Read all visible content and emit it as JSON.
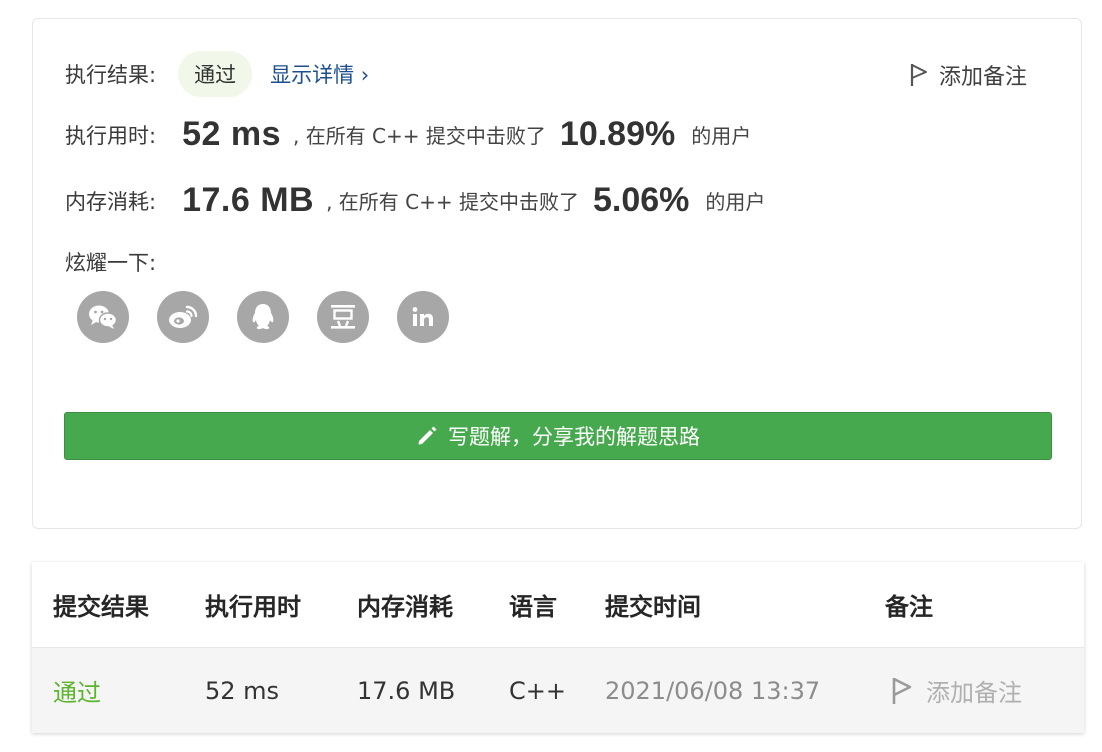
{
  "result": {
    "exec_result_label": "执行结果:",
    "status": "通过",
    "details_link": "显示详情 ›",
    "add_note": "添加备注"
  },
  "runtime": {
    "label": "执行用时:",
    "value": "52 ms",
    "middle_text": ", 在所有 C++ 提交中击败了",
    "percent": "10.89%",
    "suffix": "的用户"
  },
  "memory": {
    "label": "内存消耗:",
    "value": "17.6 MB",
    "middle_text": ", 在所有 C++ 提交中击败了",
    "percent": "5.06%",
    "suffix": "的用户"
  },
  "share": {
    "label": "炫耀一下:",
    "icons": [
      "wechat-icon",
      "weibo-icon",
      "qq-icon",
      "douban-icon",
      "linkedin-icon"
    ]
  },
  "write_solution": "写题解，分享我的解题思路",
  "table": {
    "headers": [
      "提交结果",
      "执行用时",
      "内存消耗",
      "语言",
      "提交时间",
      "备注"
    ],
    "row": {
      "status": "通过",
      "runtime": "52 ms",
      "memory": "17.6 MB",
      "language": "C++",
      "time": "2021/06/08 13:37",
      "note": "添加备注"
    }
  },
  "colors": {
    "pass": "#5cb52c",
    "button": "#47a94d",
    "link": "#1c4f8f",
    "pill_bg": "#f1f8ea"
  }
}
